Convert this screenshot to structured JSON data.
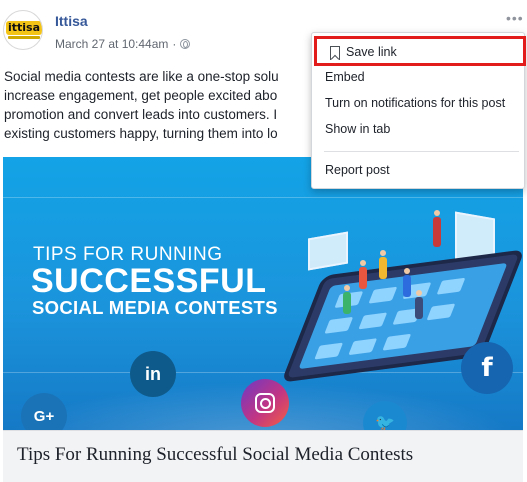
{
  "post": {
    "author": "Ittisa",
    "avatar_text": "ittisa",
    "timestamp": "March 27 at 10:44am",
    "meta_separator": "·",
    "more_icon": "•••",
    "text_lines": [
      "Social media contests are like a one-stop solu",
      "increase engagement, get people excited abo",
      "promotion and convert leads into customers. I",
      "existing customers happy, turning them into lo"
    ]
  },
  "banner": {
    "line1": "TIPS FOR RUNNING",
    "line2": "SUCCESSFUL",
    "line3": "SOCIAL MEDIA CONTESTS",
    "social_icons": {
      "linkedin": "in",
      "googleplus": "G+",
      "twitter": "🐦",
      "facebook": "f"
    }
  },
  "link_preview": {
    "title": "Tips For Running Successful Social Media Contests"
  },
  "menu": {
    "items": [
      "Save link",
      "Embed",
      "Turn on notifications for this post",
      "Show in tab",
      "Report post"
    ],
    "highlight_color": "#e21b1b"
  },
  "colors": {
    "author_link": "#365899",
    "banner_blue": "#13a3e6"
  }
}
